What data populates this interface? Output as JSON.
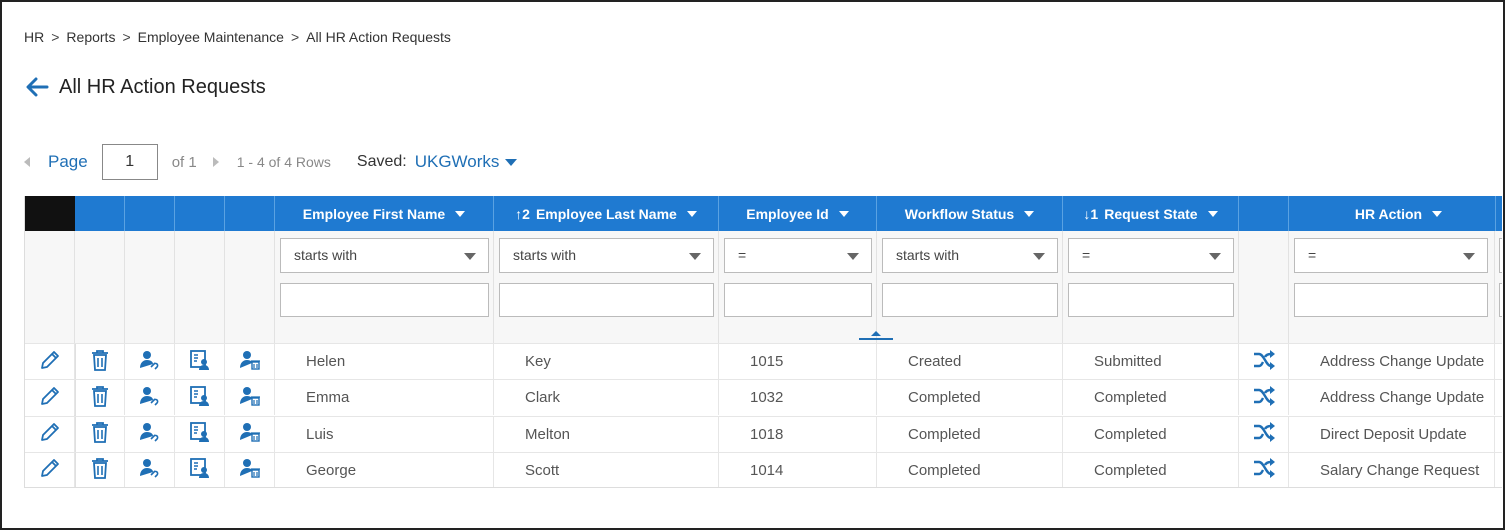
{
  "breadcrumb": [
    "HR",
    "Reports",
    "Employee Maintenance",
    "All HR Action Requests"
  ],
  "breadcrumb_sep": ">",
  "page_title": "All HR Action Requests",
  "pager": {
    "page_label": "Page",
    "page_value": "1",
    "of_label": "of 1",
    "rows_label": "1 - 4 of 4 Rows",
    "saved_label": "Saved:",
    "saved_value": "UKGWorks"
  },
  "columns": [
    {
      "label": "Employee First Name",
      "sort": ""
    },
    {
      "label": "Employee Last Name",
      "sort": "↑2"
    },
    {
      "label": "Employee Id",
      "sort": ""
    },
    {
      "label": "Workflow Status",
      "sort": ""
    },
    {
      "label": "Request State",
      "sort": "↓1"
    },
    {
      "label": "",
      "sort": ""
    },
    {
      "label": "HR Action",
      "sort": ""
    }
  ],
  "filters": [
    "starts with",
    "starts with",
    "=",
    "starts with",
    "=",
    "="
  ],
  "row_icons": [
    "pencil-icon",
    "trash-icon",
    "user-link-icon",
    "employee-card-icon",
    "user-delete-icon",
    "shuffle-icon"
  ],
  "rows": [
    {
      "first": "Helen",
      "last": "Key",
      "id": "1015",
      "workflow": "Created",
      "state": "Submitted",
      "action": "Address Change Update"
    },
    {
      "first": "Emma",
      "last": "Clark",
      "id": "1032",
      "workflow": "Completed",
      "state": "Completed",
      "action": "Address Change Update"
    },
    {
      "first": "Luis",
      "last": "Melton",
      "id": "1018",
      "workflow": "Completed",
      "state": "Completed",
      "action": "Direct Deposit Update"
    },
    {
      "first": "George",
      "last": "Scott",
      "id": "1014",
      "workflow": "Completed",
      "state": "Completed",
      "action": "Salary Change Request"
    }
  ],
  "colors": {
    "accent": "#1f7ad1",
    "link": "#1f6fb5",
    "icon": "#1f6fb5"
  }
}
